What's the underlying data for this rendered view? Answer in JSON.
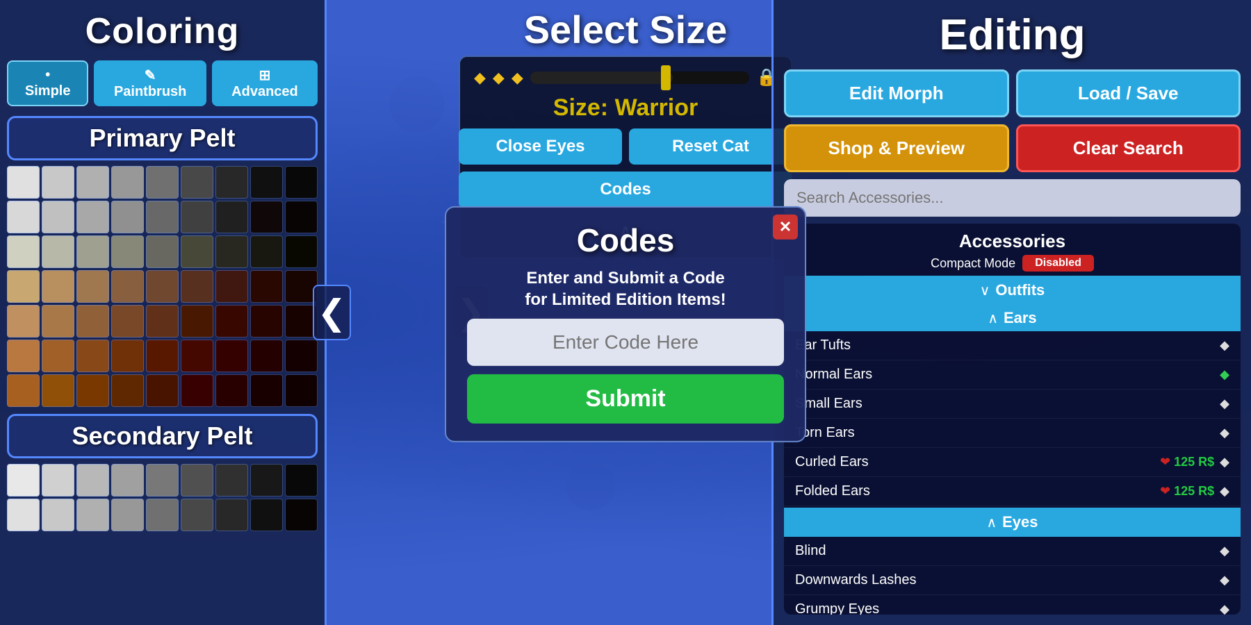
{
  "background": {
    "color": "#3a5fcd"
  },
  "left_panel": {
    "title": "Coloring",
    "buttons": [
      {
        "label": "• Simple",
        "active": true
      },
      {
        "label": "✎ Paintbrush",
        "active": false
      },
      {
        "label": "⊞ Advanced",
        "active": false
      }
    ],
    "primary_pelt_title": "Primary Pelt",
    "secondary_pelt_title": "Secondary Pelt",
    "primary_colors": [
      "#e0e0e0",
      "#c8c8c8",
      "#b0b0b0",
      "#989898",
      "#707070",
      "#484848",
      "#282828",
      "#101010",
      "#080808",
      "#d8d8d8",
      "#c0c0c0",
      "#a8a8a8",
      "#909090",
      "#686868",
      "#404040",
      "#202020",
      "#100808",
      "#080404",
      "#d0d0c0",
      "#b8b8a8",
      "#a0a090",
      "#888878",
      "#686860",
      "#484838",
      "#282820",
      "#181810",
      "#080800",
      "#c8a870",
      "#b89060",
      "#a07850",
      "#886040",
      "#704830",
      "#583020",
      "#401810",
      "#280800",
      "#180400",
      "#c09060",
      "#a87848",
      "#906038",
      "#784828",
      "#603018",
      "#481800",
      "#380800",
      "#280400",
      "#180200",
      "#b87840",
      "#a06028",
      "#884818",
      "#703008",
      "#581800",
      "#440800",
      "#340000",
      "#240000",
      "#140000",
      "#a86020",
      "#905008",
      "#783800",
      "#602800",
      "#481400",
      "#380000",
      "#280000",
      "#180000",
      "#100000"
    ],
    "secondary_colors": [
      "#e8e8e8",
      "#d0d0d0",
      "#b8b8b8",
      "#a0a0a0",
      "#787878",
      "#505050",
      "#303030",
      "#181818",
      "#080808",
      "#e0e0e0",
      "#c8c8c8",
      "#b0b0b0",
      "#989898",
      "#707070",
      "#484848",
      "#282828",
      "#101010",
      "#080404"
    ]
  },
  "center_panel": {
    "select_size_title": "Select Size",
    "size_label": "Size: Warrior",
    "close_eyes_btn": "Close Eyes",
    "reset_cat_btn": "Reset Cat",
    "codes_btn": "Codes",
    "chevron_up": "^"
  },
  "codes_modal": {
    "title": "Codes",
    "subtitle": "Enter and Submit a Code\nfor Limited Edition Items!",
    "input_placeholder": "Enter Code Here",
    "submit_btn": "Submit",
    "close_btn": "✕"
  },
  "right_panel": {
    "title": "Editing",
    "edit_morph_btn": "Edit Morph",
    "load_save_btn": "Load / Save",
    "shop_preview_btn": "Shop & Preview",
    "clear_search_btn": "Clear Search",
    "search_placeholder": "Search Accessories...",
    "accessories_title": "Accessories",
    "compact_mode_label": "Compact Mode",
    "compact_mode_value": "Disabled",
    "categories": [
      {
        "name": "Outfits",
        "expanded": true,
        "sub_categories": [
          {
            "name": "Ears",
            "expanded": true,
            "items": [
              {
                "name": "Ear Tufts",
                "owned": false,
                "active": false
              },
              {
                "name": "Normal Ears",
                "owned": true,
                "active": true
              },
              {
                "name": "Small Ears",
                "owned": false,
                "active": false
              },
              {
                "name": "Torn Ears",
                "owned": false,
                "active": false
              },
              {
                "name": "Curled Ears",
                "owned": false,
                "active": false,
                "price": "125 R$"
              },
              {
                "name": "Folded Ears",
                "owned": false,
                "active": false,
                "price": "125 R$"
              }
            ]
          }
        ]
      },
      {
        "name": "Eyes",
        "expanded": true,
        "sub_categories": [],
        "items": [
          {
            "name": "Blind",
            "owned": false,
            "active": false
          },
          {
            "name": "Downwards Lashes",
            "owned": false,
            "active": false
          },
          {
            "name": "Grumpy Eyes",
            "owned": false,
            "active": false
          }
        ]
      }
    ]
  },
  "nav_arrows": {
    "left": "❮",
    "right": "❯"
  }
}
